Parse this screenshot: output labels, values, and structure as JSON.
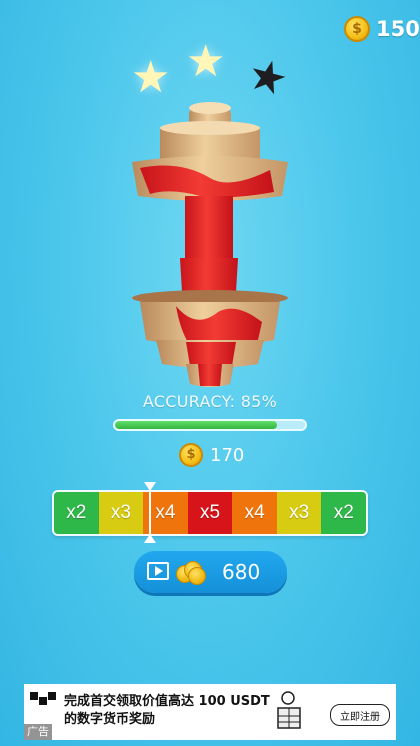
{
  "currency": {
    "coin_icon": "coin-icon",
    "total": "150"
  },
  "stars": {
    "earned": 2,
    "max": 3
  },
  "result": {
    "accuracy_label": "ACCURACY: 85%",
    "accuracy_value": 0.85,
    "reward_amount": "170"
  },
  "multiplier_bar": {
    "items": [
      {
        "label": "x2",
        "color": "#2fb84a"
      },
      {
        "label": "x3",
        "color": "#d8cc12"
      },
      {
        "label": "x4",
        "color": "#f0740c"
      },
      {
        "label": "x5",
        "color": "#d7141a"
      },
      {
        "label": "x4",
        "color": "#f0740c"
      },
      {
        "label": "x3",
        "color": "#d8cc12"
      },
      {
        "label": "x2",
        "color": "#2fb84a"
      }
    ]
  },
  "claim_button": {
    "icon": "play-video-icon",
    "amount": "680"
  },
  "ad": {
    "brand_icon": "okx-logo",
    "title": "完成首交领取价值高达 100 USDT",
    "subtitle": "的数字货币奖励",
    "cta": "立即注册",
    "tag": "广告"
  }
}
